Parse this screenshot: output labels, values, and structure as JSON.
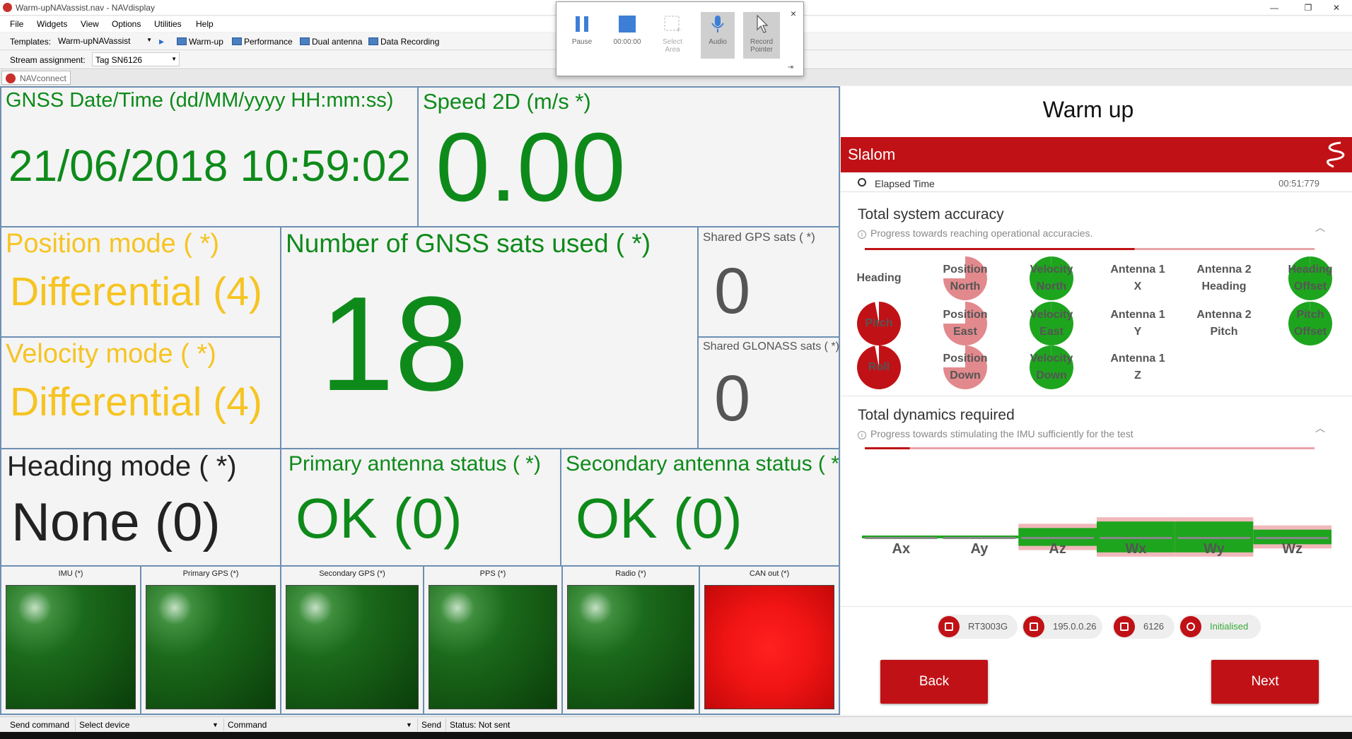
{
  "window": {
    "title": "Warm-upNAVassist.nav - NAVdisplay",
    "minimize": "—",
    "maximize": "❐",
    "close": "✕"
  },
  "menu": [
    "File",
    "Widgets",
    "View",
    "Options",
    "Utilities",
    "Help"
  ],
  "toolbar": {
    "templates_label": "Templates:",
    "templates_value": "Warm-upNAVassist",
    "play": "▸",
    "buttons": [
      "Warm-up",
      "Performance",
      "Dual antenna",
      "Data Recording"
    ],
    "stream_label": "Stream assignment:",
    "stream_value": "Tag SN6126"
  },
  "tab": {
    "label": "NAVconnect"
  },
  "recorder": {
    "pause": "Pause",
    "time": "00:00:00",
    "select_area": "Select Area",
    "audio": "Audio",
    "record_pointer": "Record Pointer",
    "close": "×",
    "pin": "⇥"
  },
  "panels": {
    "datetime": {
      "label": "GNSS Date/Time (dd/MM/yyyy HH:mm:ss)",
      "value": "21/06/2018 10:59:02"
    },
    "speed": {
      "label": "Speed 2D (m/s *)",
      "value": "0.00"
    },
    "position_mode": {
      "label": "Position mode ( *)",
      "value": "Differential (4)"
    },
    "velocity_mode": {
      "label": "Velocity mode ( *)",
      "value": "Differential (4)"
    },
    "sats": {
      "label": "Number of GNSS sats used ( *)",
      "value": "18"
    },
    "gps_sats": {
      "label": "Shared GPS sats ( *)",
      "value": "0"
    },
    "glonass_sats": {
      "label": "Shared GLONASS sats ( *)",
      "value": "0"
    },
    "heading_mode": {
      "label": "Heading mode ( *)",
      "value": "None (0)"
    },
    "primary_antenna": {
      "label": "Primary antenna status ( *)",
      "value": "OK (0)"
    },
    "secondary_antenna": {
      "label": "Secondary antenna status ( *)",
      "value": "OK (0)"
    }
  },
  "indicators": [
    {
      "label": "IMU (*)",
      "state": "ok"
    },
    {
      "label": "Primary GPS (*)",
      "state": "ok"
    },
    {
      "label": "Secondary GPS (*)",
      "state": "ok"
    },
    {
      "label": "PPS (*)",
      "state": "ok"
    },
    {
      "label": "Radio (*)",
      "state": "ok"
    },
    {
      "label": "CAN out (*)",
      "state": "error"
    }
  ],
  "warmup": {
    "title": "Warm up",
    "test": "Slalom",
    "elapsed_label": "Elapsed Time",
    "elapsed_value": "00:51:779",
    "accuracy": {
      "title": "Total system accuracy",
      "subtitle": "Progress towards reaching operational accuracies.",
      "progress": 0.6,
      "items": [
        {
          "line1": "Heading",
          "line2": "",
          "state": "none",
          "fill": 0
        },
        {
          "line1": "Position",
          "line2": "North",
          "state": "pink",
          "fill": 0.75
        },
        {
          "line1": "Velocity",
          "line2": "North",
          "state": "green",
          "fill": 1
        },
        {
          "line1": "Antenna 1",
          "line2": "X",
          "state": "none",
          "fill": 0
        },
        {
          "line1": "Antenna 2",
          "line2": "Heading",
          "state": "none",
          "fill": 0
        },
        {
          "line1": "Heading",
          "line2": "Offset",
          "state": "green",
          "fill": 1
        },
        {
          "line1": "Pitch",
          "line2": "",
          "state": "red",
          "fill": 0.97
        },
        {
          "line1": "Position",
          "line2": "East",
          "state": "pink",
          "fill": 0.75
        },
        {
          "line1": "Velocity",
          "line2": "East",
          "state": "green",
          "fill": 1
        },
        {
          "line1": "Antenna 1",
          "line2": "Y",
          "state": "none",
          "fill": 0
        },
        {
          "line1": "Antenna 2",
          "line2": "Pitch",
          "state": "none",
          "fill": 0
        },
        {
          "line1": "Pitch",
          "line2": "Offset",
          "state": "green",
          "fill": 1
        },
        {
          "line1": "Roll",
          "line2": "",
          "state": "red",
          "fill": 0.97
        },
        {
          "line1": "Position",
          "line2": "Down",
          "state": "pink",
          "fill": 0.75
        },
        {
          "line1": "Velocity",
          "line2": "Down",
          "state": "green",
          "fill": 1
        },
        {
          "line1": "Antenna 1",
          "line2": "Z",
          "state": "none",
          "fill": 0
        }
      ]
    },
    "dynamics": {
      "title": "Total dynamics required",
      "subtitle": "Progress towards stimulating the IMU sufficiently for the test",
      "progress": 0.1,
      "axes": [
        {
          "name": "Ax",
          "level": 0.08
        },
        {
          "name": "Ay",
          "level": 0.05
        },
        {
          "name": "Az",
          "level": 0.55
        },
        {
          "name": "Wx",
          "level": 0.95
        },
        {
          "name": "Wy",
          "level": 0.95
        },
        {
          "name": "Wz",
          "level": 0.45
        }
      ]
    },
    "info": [
      {
        "icon": "device-icon",
        "text": "RT3003G"
      },
      {
        "icon": "network-icon",
        "text": "195.0.0.26"
      },
      {
        "icon": "serial-icon",
        "text": "6126"
      },
      {
        "icon": "power-icon",
        "text": "Initialised"
      }
    ],
    "back": "Back",
    "next": "Next"
  },
  "statusbar": {
    "send_command": "Send command",
    "select_device": "Select device",
    "command": "Command",
    "send": "Send",
    "status": "Status: Not sent"
  },
  "colors": {
    "accent_red": "#c01216",
    "green": "#0e8a1a",
    "yellow": "#f6c422",
    "pink": "#e2898d",
    "panel_border": "#6d8fb3"
  }
}
